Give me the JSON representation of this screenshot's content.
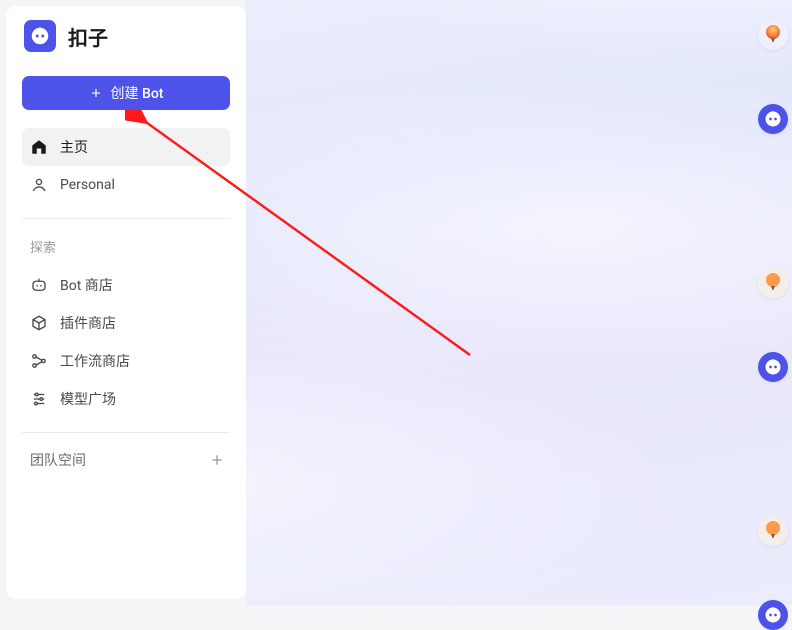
{
  "brand": {
    "name": "扣子"
  },
  "create_button": {
    "label": "创建 Bot"
  },
  "nav": {
    "home": "主页",
    "personal": "Personal"
  },
  "explore": {
    "title": "探索",
    "items": {
      "bot_store": "Bot 商店",
      "plugin_store": "插件商店",
      "workflow_store": "工作流商店",
      "model_square": "模型广场"
    }
  },
  "team_space": {
    "title": "团队空间"
  },
  "colors": {
    "primary": "#4D53E8"
  },
  "floating_avatars": [
    {
      "type": "balloon"
    },
    {
      "type": "brand"
    },
    {
      "type": "balloon"
    },
    {
      "type": "brand"
    },
    {
      "type": "balloon"
    },
    {
      "type": "brand"
    }
  ]
}
